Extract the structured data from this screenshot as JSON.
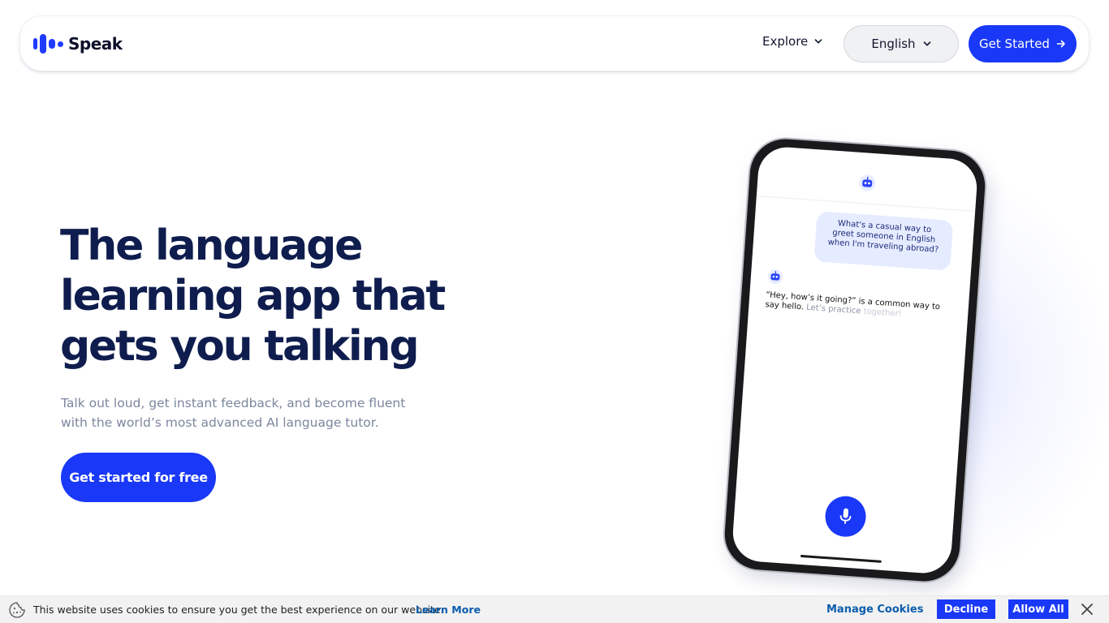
{
  "brand": {
    "name": "Speak",
    "color": "#1938f7"
  },
  "nav": {
    "explore_label": "Explore",
    "language_label": "English",
    "get_started_label": "Get Started"
  },
  "hero": {
    "title_line1": "The language",
    "title_line2": "learning app that",
    "title_line3": "gets you talking",
    "subtitle": "Talk out loud, get instant feedback, and become fluent with the world’s most advanced AI language tutor.",
    "cta_label": "Get started for free"
  },
  "phone": {
    "user_message": "What's a casual way to greet someone in English when I'm traveling abroad?",
    "reply_main": "“Hey, how’s it going?” is a common way to say hello.",
    "reply_fade1": " Let’s practice",
    "reply_fade2": " together!"
  },
  "cookie": {
    "text": "This website uses cookies to ensure you get the best experience on our website.",
    "learn_more": "Learn More",
    "manage": "Manage Cookies",
    "decline": "Decline",
    "allow": "Allow All"
  }
}
